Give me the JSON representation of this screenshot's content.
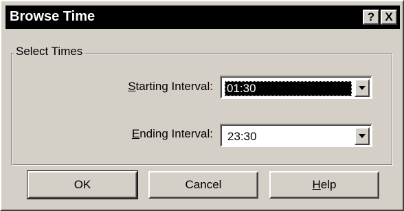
{
  "window": {
    "title": "Browse Time",
    "help_button_label": "?",
    "close_button_label": "X"
  },
  "group": {
    "label": "Select Times"
  },
  "starting_interval": {
    "label_accel": "S",
    "label_rest": "tarting Interval:",
    "value": "01:30"
  },
  "ending_interval": {
    "label_accel": "E",
    "label_rest": "nding Interval:",
    "value": "23:30"
  },
  "buttons": {
    "ok": "OK",
    "cancel": "Cancel",
    "help_accel": "H",
    "help_rest": "elp"
  }
}
